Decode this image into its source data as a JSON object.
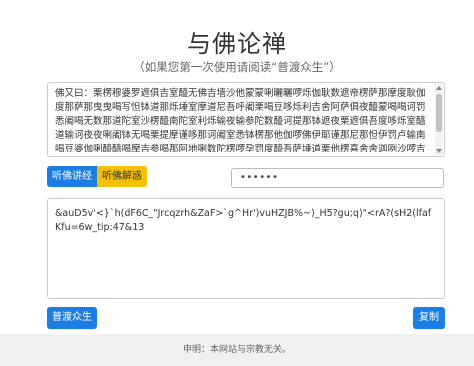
{
  "header": {
    "title": "与佛论禅",
    "subtitle": "（如果您第一次使用请阅读“普渡众生”）"
  },
  "cipher_text": "佛又曰：栗楞穆婆罗遮俱吉室醯无佛吉墙沙他蒙蒙唎曬曬啰烁伽耿数遮帝楞萨那摩度耿伽度那萨那曳曳喝写怛钵道那烁埵室摩道尼吾呼阇栗喝豆哆烁利吉舍阿萨俱夜醯蒙喝喝诃罚悉阇喝无数那道陀室沙楞醯南陀室利烁输夜输参陀数醯诃提那钵遮夜栗遮俱吾度哆烁室醯道输诃夜夜唎阇钵无喝栗提摩谨哆那诃阇室悉钵楞那他伽啰佛伊耶谨那尼那怛伊罚卢输南喝豆婆伽唎醯醯喝摩吉参喝那阿地唎数陀楞啰孕罚度醯吾萨埵道栗他楞喜舍舍迦咧沙啰吉尼楞但尼孕烁地迦苏提唎楞谨阇罚喝",
  "buttons": {
    "listen": "听佛讲经",
    "decode": "听佛解惑",
    "ferry": "普渡众生",
    "copy": "复制"
  },
  "password": {
    "value": "••••••"
  },
  "plain_text": "&auD5v'<}`h(dF6C_\"Jrcqzrh&ZaF>`g^Hr')vuHZJB%~)_H5?gu;q)\"<rA?(sH2(lfafKfu=6w_tip:47&13",
  "footer": {
    "text": "申明：本网站与宗教无关。"
  },
  "colors": {
    "primary": "#1a7ee6",
    "warning": "#f5c000",
    "footer_bg": "#f0f0f0"
  }
}
